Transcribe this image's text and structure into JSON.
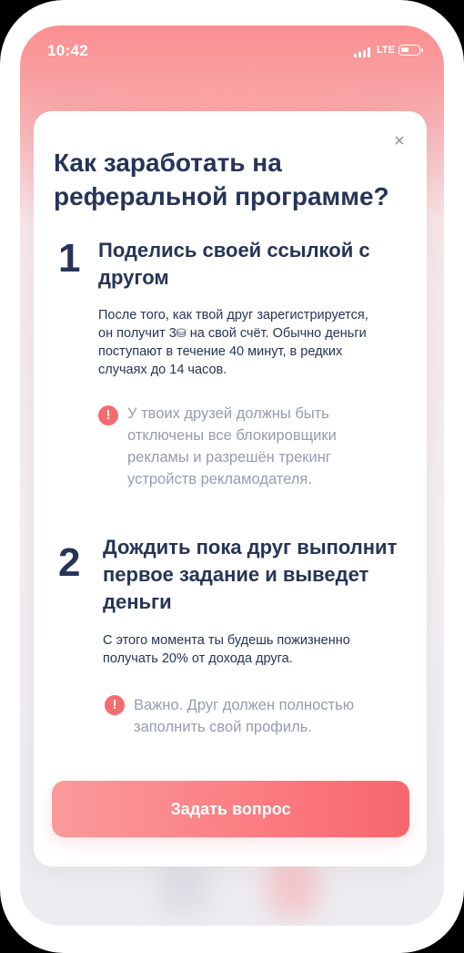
{
  "status_bar": {
    "time": "10:42",
    "network": "LTE"
  },
  "modal": {
    "close_glyph": "×",
    "title": "Как заработать на реферальной программе?",
    "steps": [
      {
        "number": "1",
        "title": "Поделись своей ссылкой с другом",
        "body_line1": "После того, как твой друг зарегистрируется,",
        "body_line2": "он получит 3",
        "coin_glyph": "⛁",
        "body_line2_tail": "на свой счёт. Обычно деньги",
        "body_line3": "поступают в течение 40 минут, в редких",
        "body_line4": "случаях до 14 часов.",
        "warning_icon": "!",
        "warning": "У твоих друзей должны быть отключены все блокировщики рекламы и разрешён трекинг устройств рекламодателя."
      },
      {
        "number": "2",
        "title": "Дождить пока друг выполнит первое задание и выведет деньги",
        "body": "С этого момента ты будешь пожизненно получать 20% от дохода друга.",
        "warning_icon": "!",
        "warning": "Важно. Друг должен полностью заполнить свой профиль."
      }
    ],
    "button_label": "Задать вопрос"
  },
  "colors": {
    "accent": "#f46c70",
    "heading": "#263456",
    "muted": "#959cb0",
    "button_gradient_start": "#fb9a9a",
    "button_gradient_end": "#f8666d"
  },
  "icons": [
    "signal-icon",
    "battery-icon",
    "close-icon",
    "coin-icon",
    "warning-icon"
  ]
}
